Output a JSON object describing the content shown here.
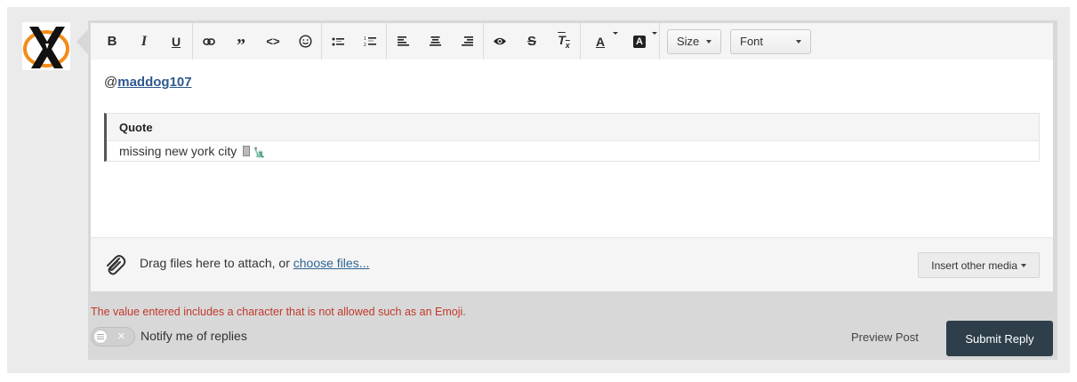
{
  "avatar": {
    "icon": "x-logo-icon"
  },
  "toolbar": {
    "buttons": [
      {
        "name": "bold-button",
        "icon": "bold-icon"
      },
      {
        "name": "italic-button",
        "icon": "italic-icon"
      },
      {
        "name": "underline-button",
        "icon": "underline-icon"
      },
      {
        "name": "link-button",
        "icon": "link-icon"
      },
      {
        "name": "quote-button",
        "icon": "quote-icon"
      },
      {
        "name": "code-button",
        "icon": "code-icon"
      },
      {
        "name": "emoji-button",
        "icon": "smiley-icon"
      },
      {
        "name": "bullet-list-button",
        "icon": "bullet-list-icon"
      },
      {
        "name": "numbered-list-button",
        "icon": "numbered-list-icon"
      },
      {
        "name": "align-left-button",
        "icon": "align-left-icon"
      },
      {
        "name": "align-center-button",
        "icon": "align-center-icon"
      },
      {
        "name": "align-right-button",
        "icon": "align-right-icon"
      },
      {
        "name": "preview-toggle-button",
        "icon": "eye-icon"
      },
      {
        "name": "strikethrough-button",
        "icon": "strikethrough-icon"
      },
      {
        "name": "clear-format-button",
        "icon": "clear-format-icon"
      },
      {
        "name": "text-color-button",
        "icon": "text-color-icon"
      },
      {
        "name": "background-color-button",
        "icon": "background-color-icon"
      }
    ],
    "size_label": "Size",
    "font_label": "Font"
  },
  "content": {
    "at": "@",
    "mention": "maddog107"
  },
  "quote": {
    "title": "Quote",
    "text": "missing new york city"
  },
  "attach": {
    "prefix": "Drag files here to attach, or ",
    "link": "choose files...",
    "insert_media": "Insert other media"
  },
  "error": "The value entered includes a character that is not allowed such as an Emoji.",
  "notify_label": "Notify me of replies",
  "preview_label": "Preview Post",
  "submit_label": "Submit Reply",
  "colors": {
    "submit_bg": "#2e3f4b",
    "error": "#c0392b",
    "link": "#2f6491"
  }
}
